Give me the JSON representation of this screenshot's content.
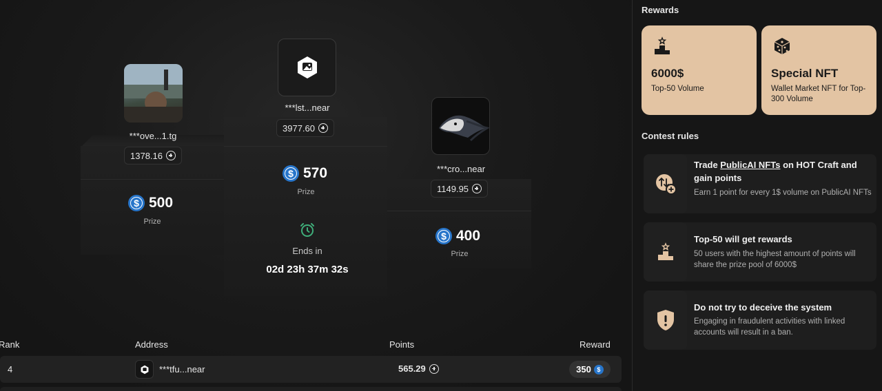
{
  "podium": {
    "second": {
      "name": "***ove...1.tg",
      "points": "1378.16",
      "prize": "500",
      "prize_label": "Prize"
    },
    "first": {
      "name": "***lst...near",
      "points": "3977.60",
      "prize": "570",
      "prize_label": "Prize"
    },
    "third": {
      "name": "***cro...near",
      "points": "1149.95",
      "prize": "400",
      "prize_label": "Prize"
    }
  },
  "timer": {
    "label": "Ends in",
    "value": "02d 23h 37m 32s"
  },
  "table": {
    "headers": {
      "rank": "Rank",
      "address": "Address",
      "points": "Points",
      "reward": "Reward"
    },
    "rows": [
      {
        "rank": "4",
        "address": "***tfu...near",
        "points": "565.29",
        "reward": "350"
      }
    ]
  },
  "sidebar": {
    "rewards_title": "Rewards",
    "reward_cards": [
      {
        "value": "6000$",
        "desc": "Top-50 Volume"
      },
      {
        "value": "Special NFT",
        "desc": "Wallet Market NFT for Top-300 Volume"
      }
    ],
    "rules_title": "Contest rules",
    "rules": [
      {
        "title_pre": "Trade ",
        "title_link": "PublicAI NFTs",
        "title_post": " on HOT Craft and gain points",
        "desc": "Earn 1 point for every 1$ volume on PublicAI NFTs"
      },
      {
        "title": "Top-50 will get rewards",
        "desc": "50 users with the highest amount of points will share the prize pool of 6000$"
      },
      {
        "title": "Do not try to deceive the system",
        "desc": "Engaging in fraudulent activities with linked accounts will result in a ban."
      }
    ]
  },
  "colors": {
    "card_bg": "#e3c4a3",
    "usdc_blue": "#2775ca",
    "alarm_green": "#3fae7a"
  },
  "icons": {
    "podium": "podium-star-icon",
    "nft": "dice-icon",
    "plus": "plus-circle-icon",
    "usdc": "usdc-icon",
    "alarm": "alarm-clock-icon",
    "shield": "shield-alert-icon"
  }
}
